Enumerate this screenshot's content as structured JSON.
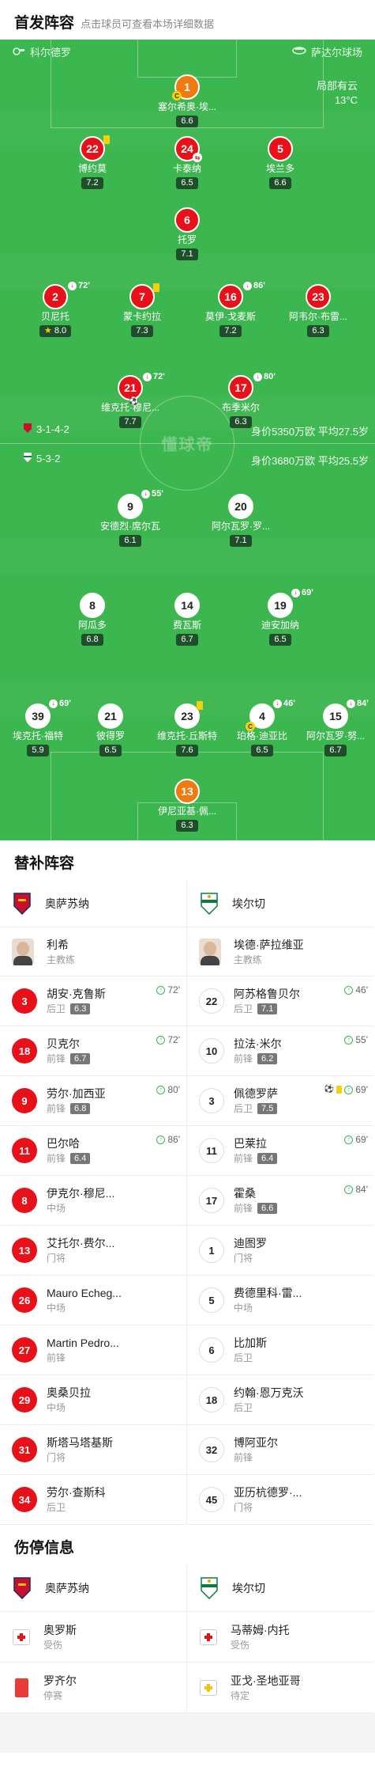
{
  "lineup": {
    "title": "首发阵容",
    "hint": "点击球员可查看本场详细数据"
  },
  "pitch": {
    "home_team": "科尔德罗",
    "venue": "萨达尔球场",
    "weather": "局部有云",
    "temperature": "13°C",
    "home_formation": "3-1-4-2",
    "home_value": "身价5350万欧 平均27.5岁",
    "away_formation": "5-3-2",
    "away_value": "身价3680万欧 平均25.5岁",
    "logo": "懂球帝"
  },
  "players": [
    {
      "num": "1",
      "name": "塞尔希奥·埃...",
      "rating": "6.6",
      "style": "gk",
      "captain": "C"
    },
    {
      "num": "22",
      "name": "博约莫",
      "rating": "7.2",
      "style": "red",
      "yellow": true
    },
    {
      "num": "24",
      "name": "卡泰纳",
      "rating": "6.5",
      "style": "red",
      "subbed_icon": "⇆"
    },
    {
      "num": "5",
      "name": "埃兰多",
      "rating": "6.6",
      "style": "red"
    },
    {
      "num": "6",
      "name": "托罗",
      "rating": "7.1",
      "style": "red"
    },
    {
      "num": "2",
      "name": "贝尼托",
      "rating": "8.0",
      "style": "red",
      "sub_min": "72'",
      "star": "★"
    },
    {
      "num": "7",
      "name": "蒙卡约拉",
      "rating": "7.3",
      "style": "red",
      "yellow": true
    },
    {
      "num": "16",
      "name": "莫伊·戈麦斯",
      "rating": "7.2",
      "style": "red",
      "sub_min": "86'"
    },
    {
      "num": "23",
      "name": "阿韦尔·布雷...",
      "rating": "6.3",
      "style": "red"
    },
    {
      "num": "21",
      "name": "维克托·穆尼...",
      "rating": "7.7",
      "style": "red",
      "sub_min": "72'",
      "goal": "⚽"
    },
    {
      "num": "17",
      "name": "布季米尔",
      "rating": "6.3",
      "style": "red",
      "sub_min": "80'"
    },
    {
      "num": "9",
      "name": "安德烈·席尔瓦",
      "rating": "6.1",
      "style": "white",
      "sub_min": "55'"
    },
    {
      "num": "20",
      "name": "阿尔瓦罗·罗...",
      "rating": "7.1",
      "style": "white"
    },
    {
      "num": "8",
      "name": "阿瓜多",
      "rating": "6.8",
      "style": "white"
    },
    {
      "num": "14",
      "name": "费瓦斯",
      "rating": "6.7",
      "style": "white"
    },
    {
      "num": "19",
      "name": "迪安加纳",
      "rating": "6.5",
      "style": "white",
      "sub_min": "69'"
    },
    {
      "num": "39",
      "name": "埃克托·福特",
      "rating": "5.9",
      "style": "white",
      "sub_min": "69'"
    },
    {
      "num": "21",
      "name": "彼得罗",
      "rating": "6.5",
      "style": "white"
    },
    {
      "num": "23",
      "name": "维克托·丘斯特",
      "rating": "7.6",
      "style": "white",
      "yellow": true
    },
    {
      "num": "4",
      "name": "珀格·迪亚比",
      "rating": "6.5",
      "style": "white",
      "sub_min": "46'",
      "captain": "C"
    },
    {
      "num": "15",
      "name": "阿尔瓦罗·努...",
      "rating": "6.7",
      "style": "white",
      "sub_min": "84'"
    },
    {
      "num": "13",
      "name": "伊尼亚基·佩...",
      "rating": "6.3",
      "style": "gk"
    }
  ],
  "subs": {
    "title": "替补阵容",
    "home_team": "奥萨苏纳",
    "away_team": "埃尔切",
    "home_coach": {
      "name": "利希",
      "role": "主教练"
    },
    "away_coach": {
      "name": "埃德·萨拉维亚",
      "role": "主教练"
    },
    "home": [
      {
        "num": "3",
        "name": "胡安·克鲁斯",
        "pos": "后卫",
        "rating": "6.3",
        "event": "72'"
      },
      {
        "num": "18",
        "name": "贝克尔",
        "pos": "前锋",
        "rating": "6.7",
        "event": "72'"
      },
      {
        "num": "9",
        "name": "劳尔·加西亚",
        "pos": "前锋",
        "rating": "6.8",
        "event": "80'"
      },
      {
        "num": "11",
        "name": "巴尔哈",
        "pos": "前锋",
        "rating": "6.4",
        "event": "86'"
      },
      {
        "num": "8",
        "name": "伊克尔·穆尼...",
        "pos": "中场"
      },
      {
        "num": "13",
        "name": "艾托尔·费尔...",
        "pos": "门将"
      },
      {
        "num": "26",
        "name": "Mauro Echeg...",
        "pos": "中场"
      },
      {
        "num": "27",
        "name": "Martin Pedro...",
        "pos": "前锋"
      },
      {
        "num": "29",
        "name": "奥桑贝拉",
        "pos": "中场"
      },
      {
        "num": "31",
        "name": "斯塔马塔基斯",
        "pos": "门将"
      },
      {
        "num": "34",
        "name": "劳尔·查斯科",
        "pos": "后卫"
      }
    ],
    "away": [
      {
        "num": "22",
        "name": "阿苏格鲁贝尔",
        "pos": "后卫",
        "rating": "7.1",
        "event": "46'"
      },
      {
        "num": "10",
        "name": "拉法·米尔",
        "pos": "前锋",
        "rating": "6.2",
        "event": "55'"
      },
      {
        "num": "3",
        "name": "佩德罗萨",
        "pos": "后卫",
        "rating": "7.5",
        "event": "69'",
        "goal": true,
        "yellow": true
      },
      {
        "num": "11",
        "name": "巴莱拉",
        "pos": "前锋",
        "rating": "6.4",
        "event": "69'"
      },
      {
        "num": "17",
        "name": "霍桑",
        "pos": "前锋",
        "rating": "6.6",
        "event": "84'"
      },
      {
        "num": "1",
        "name": "迪图罗",
        "pos": "门将"
      },
      {
        "num": "5",
        "name": "费德里科·雷...",
        "pos": "中场"
      },
      {
        "num": "6",
        "name": "比加斯",
        "pos": "后卫"
      },
      {
        "num": "18",
        "name": "约翰·恩万克沃",
        "pos": "后卫"
      },
      {
        "num": "32",
        "name": "博阿亚尔",
        "pos": "前锋"
      },
      {
        "num": "45",
        "name": "亚历杭德罗·...",
        "pos": "门将"
      }
    ]
  },
  "injuries": {
    "title": "伤停信息",
    "home_team": "奥萨苏纳",
    "away_team": "埃尔切",
    "home": [
      {
        "name": "奥罗斯",
        "status": "受伤",
        "icon": "kit-red"
      },
      {
        "name": "罗齐尔",
        "status": "停赛",
        "icon": "red-card"
      }
    ],
    "away": [
      {
        "name": "马蒂姆·内托",
        "status": "受伤",
        "icon": "kit-red"
      },
      {
        "name": "亚戈·圣地亚哥",
        "status": "待定",
        "icon": "kit-yellow"
      }
    ]
  },
  "colors": {
    "pitch": "#3cb64f",
    "home": "#e8111a",
    "away": "#ffffff",
    "gk": "#f07a12"
  }
}
